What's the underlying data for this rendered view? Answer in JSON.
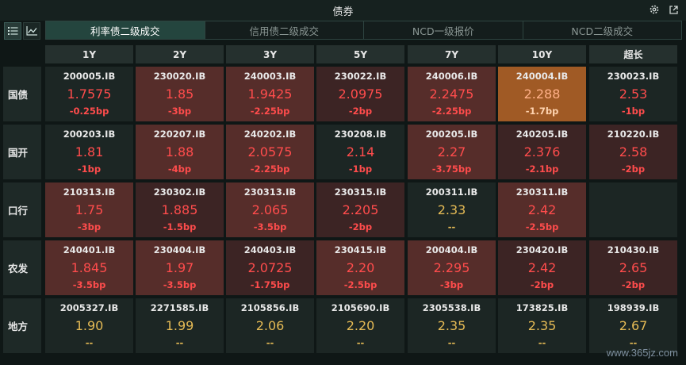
{
  "window": {
    "title": "债券"
  },
  "tabs": [
    {
      "label": "利率债二级成交",
      "active": true
    },
    {
      "label": "信用债二级成交",
      "active": false
    },
    {
      "label": "NCD一级报价",
      "active": false
    },
    {
      "label": "NCD二级成交",
      "active": false
    }
  ],
  "tenors": [
    "1Y",
    "2Y",
    "3Y",
    "5Y",
    "7Y",
    "10Y",
    "超长"
  ],
  "rows": [
    {
      "label": "国债",
      "cells": [
        {
          "code": "200005.IB",
          "yield": "1.7575",
          "change": "-0.25bp",
          "shade": "dark",
          "tone": "red"
        },
        {
          "code": "230020.IB",
          "yield": "1.85",
          "change": "-3bp",
          "shade": "red2",
          "tone": "red"
        },
        {
          "code": "240003.IB",
          "yield": "1.9425",
          "change": "-2.25bp",
          "shade": "red2",
          "tone": "red"
        },
        {
          "code": "230022.IB",
          "yield": "2.0975",
          "change": "-2bp",
          "shade": "red1",
          "tone": "red"
        },
        {
          "code": "240006.IB",
          "yield": "2.2475",
          "change": "-2.25bp",
          "shade": "red2",
          "tone": "red"
        },
        {
          "code": "240004.IB",
          "yield": "2.288",
          "change": "-1.7bp",
          "shade": "orange",
          "tone": "red"
        },
        {
          "code": "230023.IB",
          "yield": "2.53",
          "change": "-1bp",
          "shade": "dark",
          "tone": "red"
        }
      ]
    },
    {
      "label": "国开",
      "cells": [
        {
          "code": "200203.IB",
          "yield": "1.81",
          "change": "-1bp",
          "shade": "dark",
          "tone": "red"
        },
        {
          "code": "220207.IB",
          "yield": "1.88",
          "change": "-4bp",
          "shade": "red2",
          "tone": "red"
        },
        {
          "code": "240202.IB",
          "yield": "2.0575",
          "change": "-2.25bp",
          "shade": "red2",
          "tone": "red"
        },
        {
          "code": "230208.IB",
          "yield": "2.14",
          "change": "-1bp",
          "shade": "dark",
          "tone": "red"
        },
        {
          "code": "200205.IB",
          "yield": "2.27",
          "change": "-3.75bp",
          "shade": "red2",
          "tone": "red"
        },
        {
          "code": "240205.IB",
          "yield": "2.376",
          "change": "-2.1bp",
          "shade": "red1",
          "tone": "red"
        },
        {
          "code": "210220.IB",
          "yield": "2.58",
          "change": "-2bp",
          "shade": "red1",
          "tone": "red"
        }
      ]
    },
    {
      "label": "口行",
      "cells": [
        {
          "code": "210313.IB",
          "yield": "1.75",
          "change": "-3bp",
          "shade": "red2",
          "tone": "red"
        },
        {
          "code": "230302.IB",
          "yield": "1.885",
          "change": "-1.5bp",
          "shade": "red1",
          "tone": "red"
        },
        {
          "code": "230313.IB",
          "yield": "2.065",
          "change": "-3.5bp",
          "shade": "red2",
          "tone": "red"
        },
        {
          "code": "230315.IB",
          "yield": "2.205",
          "change": "-2bp",
          "shade": "red1",
          "tone": "red"
        },
        {
          "code": "200311.IB",
          "yield": "2.33",
          "change": "--",
          "shade": "dark",
          "tone": "gold"
        },
        {
          "code": "230311.IB",
          "yield": "2.42",
          "change": "-2.5bp",
          "shade": "red2",
          "tone": "red"
        },
        {
          "code": "",
          "yield": "",
          "change": "",
          "shade": "empty",
          "tone": "red"
        }
      ]
    },
    {
      "label": "农发",
      "cells": [
        {
          "code": "240401.IB",
          "yield": "1.845",
          "change": "-3.5bp",
          "shade": "red2",
          "tone": "red"
        },
        {
          "code": "230404.IB",
          "yield": "1.97",
          "change": "-3.5bp",
          "shade": "red2",
          "tone": "red"
        },
        {
          "code": "240403.IB",
          "yield": "2.0725",
          "change": "-1.75bp",
          "shade": "red1",
          "tone": "red"
        },
        {
          "code": "230415.IB",
          "yield": "2.20",
          "change": "-2.5bp",
          "shade": "red2",
          "tone": "red"
        },
        {
          "code": "200404.IB",
          "yield": "2.295",
          "change": "-3bp",
          "shade": "red2",
          "tone": "red"
        },
        {
          "code": "230420.IB",
          "yield": "2.42",
          "change": "-2bp",
          "shade": "red1",
          "tone": "red"
        },
        {
          "code": "210430.IB",
          "yield": "2.65",
          "change": "-2bp",
          "shade": "red1",
          "tone": "red"
        }
      ]
    },
    {
      "label": "地方",
      "cells": [
        {
          "code": "2005327.IB",
          "yield": "1.90",
          "change": "--",
          "shade": "dark",
          "tone": "gold"
        },
        {
          "code": "2271585.IB",
          "yield": "1.99",
          "change": "--",
          "shade": "dark",
          "tone": "gold"
        },
        {
          "code": "2105856.IB",
          "yield": "2.06",
          "change": "--",
          "shade": "dark",
          "tone": "gold"
        },
        {
          "code": "2105690.IB",
          "yield": "2.20",
          "change": "--",
          "shade": "dark",
          "tone": "gold"
        },
        {
          "code": "2305538.IB",
          "yield": "2.35",
          "change": "--",
          "shade": "dark",
          "tone": "gold"
        },
        {
          "code": "173825.IB",
          "yield": "2.35",
          "change": "--",
          "shade": "dark",
          "tone": "gold"
        },
        {
          "code": "198939.IB",
          "yield": "2.67",
          "change": "--",
          "shade": "dark",
          "tone": "gold"
        }
      ]
    }
  ],
  "icons": {
    "settings": "gear-icon",
    "popout": "external-link-icon",
    "list_view": "list-icon",
    "chart_view": "line-chart-icon"
  },
  "watermark": "www.365jz.com",
  "colors": {
    "up_red": "#ff4c4c",
    "flat_gold": "#e6bb55",
    "active_tab": "#24453e",
    "highlight_orange": "#a05a25"
  }
}
